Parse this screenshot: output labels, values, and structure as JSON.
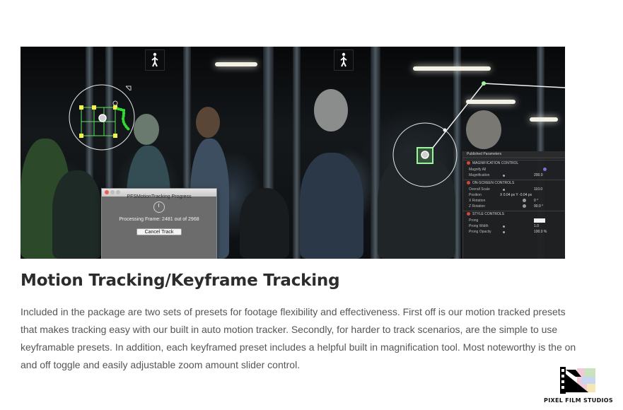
{
  "dialog": {
    "title": "PFSMotionTracking Progress",
    "status": "Processing Frame: 2481 out of 2968",
    "cancel_label": "Cancel Track"
  },
  "panel": {
    "header": "Published Parameters",
    "sections": [
      {
        "title": "MAGNIFICATION CONTROL",
        "rows": [
          {
            "label": "Magnify All",
            "value": ""
          },
          {
            "label": "Magnification",
            "value": "200.0"
          }
        ]
      },
      {
        "title": "ON-SCREEN CONTROLS",
        "rows": [
          {
            "label": "Overall Scale",
            "value": "110.0"
          },
          {
            "label": "Position",
            "value": "X 0.04 px  Y -0.04 px"
          },
          {
            "label": "X Rotation",
            "value": "0 °"
          },
          {
            "label": "Z Rotation",
            "value": "90.0 °"
          }
        ]
      },
      {
        "title": "STYLE CONTROLS",
        "rows": [
          {
            "label": "Prong",
            "value": ""
          },
          {
            "label": "Prong Width",
            "value": "1.0"
          },
          {
            "label": "Prong Opacity",
            "value": "100.0 %"
          }
        ]
      }
    ]
  },
  "article": {
    "title": "Motion Tracking/Keyframe Tracking",
    "description": "Included in the package are two sets of presets for footage flexibility and effectiveness. First off is our motion tracked presets that makes tracking easy with our built in auto motion tracker. Secondly, for harder to track scenarios, are the simple to use keyframable presets. In addition, each keyframed preset includes a helpful built in magnification tool. Most noteworthy is the on and off toggle and easily adjustable zoom amount slider control."
  },
  "brand": {
    "name": "PIXEL FILM STUDIOS"
  },
  "colors": {
    "heading": "#2c2c2c",
    "body_text": "#555555",
    "tracker_yellow": "#f2f24a",
    "tracker_green": "#5be65b",
    "close_red": "#ee5d56"
  }
}
